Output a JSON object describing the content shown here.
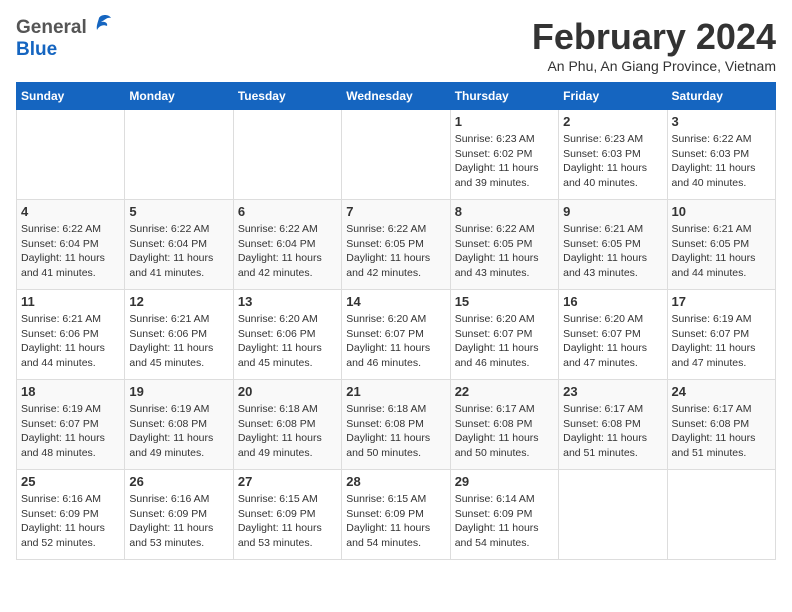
{
  "header": {
    "logo_general": "General",
    "logo_blue": "Blue",
    "title": "February 2024",
    "subtitle": "An Phu, An Giang Province, Vietnam"
  },
  "weekdays": [
    "Sunday",
    "Monday",
    "Tuesday",
    "Wednesday",
    "Thursday",
    "Friday",
    "Saturday"
  ],
  "weeks": [
    [
      {
        "day": "",
        "sunrise": "",
        "sunset": "",
        "daylight": ""
      },
      {
        "day": "",
        "sunrise": "",
        "sunset": "",
        "daylight": ""
      },
      {
        "day": "",
        "sunrise": "",
        "sunset": "",
        "daylight": ""
      },
      {
        "day": "",
        "sunrise": "",
        "sunset": "",
        "daylight": ""
      },
      {
        "day": "1",
        "sunrise": "Sunrise: 6:23 AM",
        "sunset": "Sunset: 6:02 PM",
        "daylight": "Daylight: 11 hours and 39 minutes."
      },
      {
        "day": "2",
        "sunrise": "Sunrise: 6:23 AM",
        "sunset": "Sunset: 6:03 PM",
        "daylight": "Daylight: 11 hours and 40 minutes."
      },
      {
        "day": "3",
        "sunrise": "Sunrise: 6:22 AM",
        "sunset": "Sunset: 6:03 PM",
        "daylight": "Daylight: 11 hours and 40 minutes."
      }
    ],
    [
      {
        "day": "4",
        "sunrise": "Sunrise: 6:22 AM",
        "sunset": "Sunset: 6:04 PM",
        "daylight": "Daylight: 11 hours and 41 minutes."
      },
      {
        "day": "5",
        "sunrise": "Sunrise: 6:22 AM",
        "sunset": "Sunset: 6:04 PM",
        "daylight": "Daylight: 11 hours and 41 minutes."
      },
      {
        "day": "6",
        "sunrise": "Sunrise: 6:22 AM",
        "sunset": "Sunset: 6:04 PM",
        "daylight": "Daylight: 11 hours and 42 minutes."
      },
      {
        "day": "7",
        "sunrise": "Sunrise: 6:22 AM",
        "sunset": "Sunset: 6:05 PM",
        "daylight": "Daylight: 11 hours and 42 minutes."
      },
      {
        "day": "8",
        "sunrise": "Sunrise: 6:22 AM",
        "sunset": "Sunset: 6:05 PM",
        "daylight": "Daylight: 11 hours and 43 minutes."
      },
      {
        "day": "9",
        "sunrise": "Sunrise: 6:21 AM",
        "sunset": "Sunset: 6:05 PM",
        "daylight": "Daylight: 11 hours and 43 minutes."
      },
      {
        "day": "10",
        "sunrise": "Sunrise: 6:21 AM",
        "sunset": "Sunset: 6:05 PM",
        "daylight": "Daylight: 11 hours and 44 minutes."
      }
    ],
    [
      {
        "day": "11",
        "sunrise": "Sunrise: 6:21 AM",
        "sunset": "Sunset: 6:06 PM",
        "daylight": "Daylight: 11 hours and 44 minutes."
      },
      {
        "day": "12",
        "sunrise": "Sunrise: 6:21 AM",
        "sunset": "Sunset: 6:06 PM",
        "daylight": "Daylight: 11 hours and 45 minutes."
      },
      {
        "day": "13",
        "sunrise": "Sunrise: 6:20 AM",
        "sunset": "Sunset: 6:06 PM",
        "daylight": "Daylight: 11 hours and 45 minutes."
      },
      {
        "day": "14",
        "sunrise": "Sunrise: 6:20 AM",
        "sunset": "Sunset: 6:07 PM",
        "daylight": "Daylight: 11 hours and 46 minutes."
      },
      {
        "day": "15",
        "sunrise": "Sunrise: 6:20 AM",
        "sunset": "Sunset: 6:07 PM",
        "daylight": "Daylight: 11 hours and 46 minutes."
      },
      {
        "day": "16",
        "sunrise": "Sunrise: 6:20 AM",
        "sunset": "Sunset: 6:07 PM",
        "daylight": "Daylight: 11 hours and 47 minutes."
      },
      {
        "day": "17",
        "sunrise": "Sunrise: 6:19 AM",
        "sunset": "Sunset: 6:07 PM",
        "daylight": "Daylight: 11 hours and 47 minutes."
      }
    ],
    [
      {
        "day": "18",
        "sunrise": "Sunrise: 6:19 AM",
        "sunset": "Sunset: 6:07 PM",
        "daylight": "Daylight: 11 hours and 48 minutes."
      },
      {
        "day": "19",
        "sunrise": "Sunrise: 6:19 AM",
        "sunset": "Sunset: 6:08 PM",
        "daylight": "Daylight: 11 hours and 49 minutes."
      },
      {
        "day": "20",
        "sunrise": "Sunrise: 6:18 AM",
        "sunset": "Sunset: 6:08 PM",
        "daylight": "Daylight: 11 hours and 49 minutes."
      },
      {
        "day": "21",
        "sunrise": "Sunrise: 6:18 AM",
        "sunset": "Sunset: 6:08 PM",
        "daylight": "Daylight: 11 hours and 50 minutes."
      },
      {
        "day": "22",
        "sunrise": "Sunrise: 6:17 AM",
        "sunset": "Sunset: 6:08 PM",
        "daylight": "Daylight: 11 hours and 50 minutes."
      },
      {
        "day": "23",
        "sunrise": "Sunrise: 6:17 AM",
        "sunset": "Sunset: 6:08 PM",
        "daylight": "Daylight: 11 hours and 51 minutes."
      },
      {
        "day": "24",
        "sunrise": "Sunrise: 6:17 AM",
        "sunset": "Sunset: 6:08 PM",
        "daylight": "Daylight: 11 hours and 51 minutes."
      }
    ],
    [
      {
        "day": "25",
        "sunrise": "Sunrise: 6:16 AM",
        "sunset": "Sunset: 6:09 PM",
        "daylight": "Daylight: 11 hours and 52 minutes."
      },
      {
        "day": "26",
        "sunrise": "Sunrise: 6:16 AM",
        "sunset": "Sunset: 6:09 PM",
        "daylight": "Daylight: 11 hours and 53 minutes."
      },
      {
        "day": "27",
        "sunrise": "Sunrise: 6:15 AM",
        "sunset": "Sunset: 6:09 PM",
        "daylight": "Daylight: 11 hours and 53 minutes."
      },
      {
        "day": "28",
        "sunrise": "Sunrise: 6:15 AM",
        "sunset": "Sunset: 6:09 PM",
        "daylight": "Daylight: 11 hours and 54 minutes."
      },
      {
        "day": "29",
        "sunrise": "Sunrise: 6:14 AM",
        "sunset": "Sunset: 6:09 PM",
        "daylight": "Daylight: 11 hours and 54 minutes."
      },
      {
        "day": "",
        "sunrise": "",
        "sunset": "",
        "daylight": ""
      },
      {
        "day": "",
        "sunrise": "",
        "sunset": "",
        "daylight": ""
      }
    ]
  ]
}
